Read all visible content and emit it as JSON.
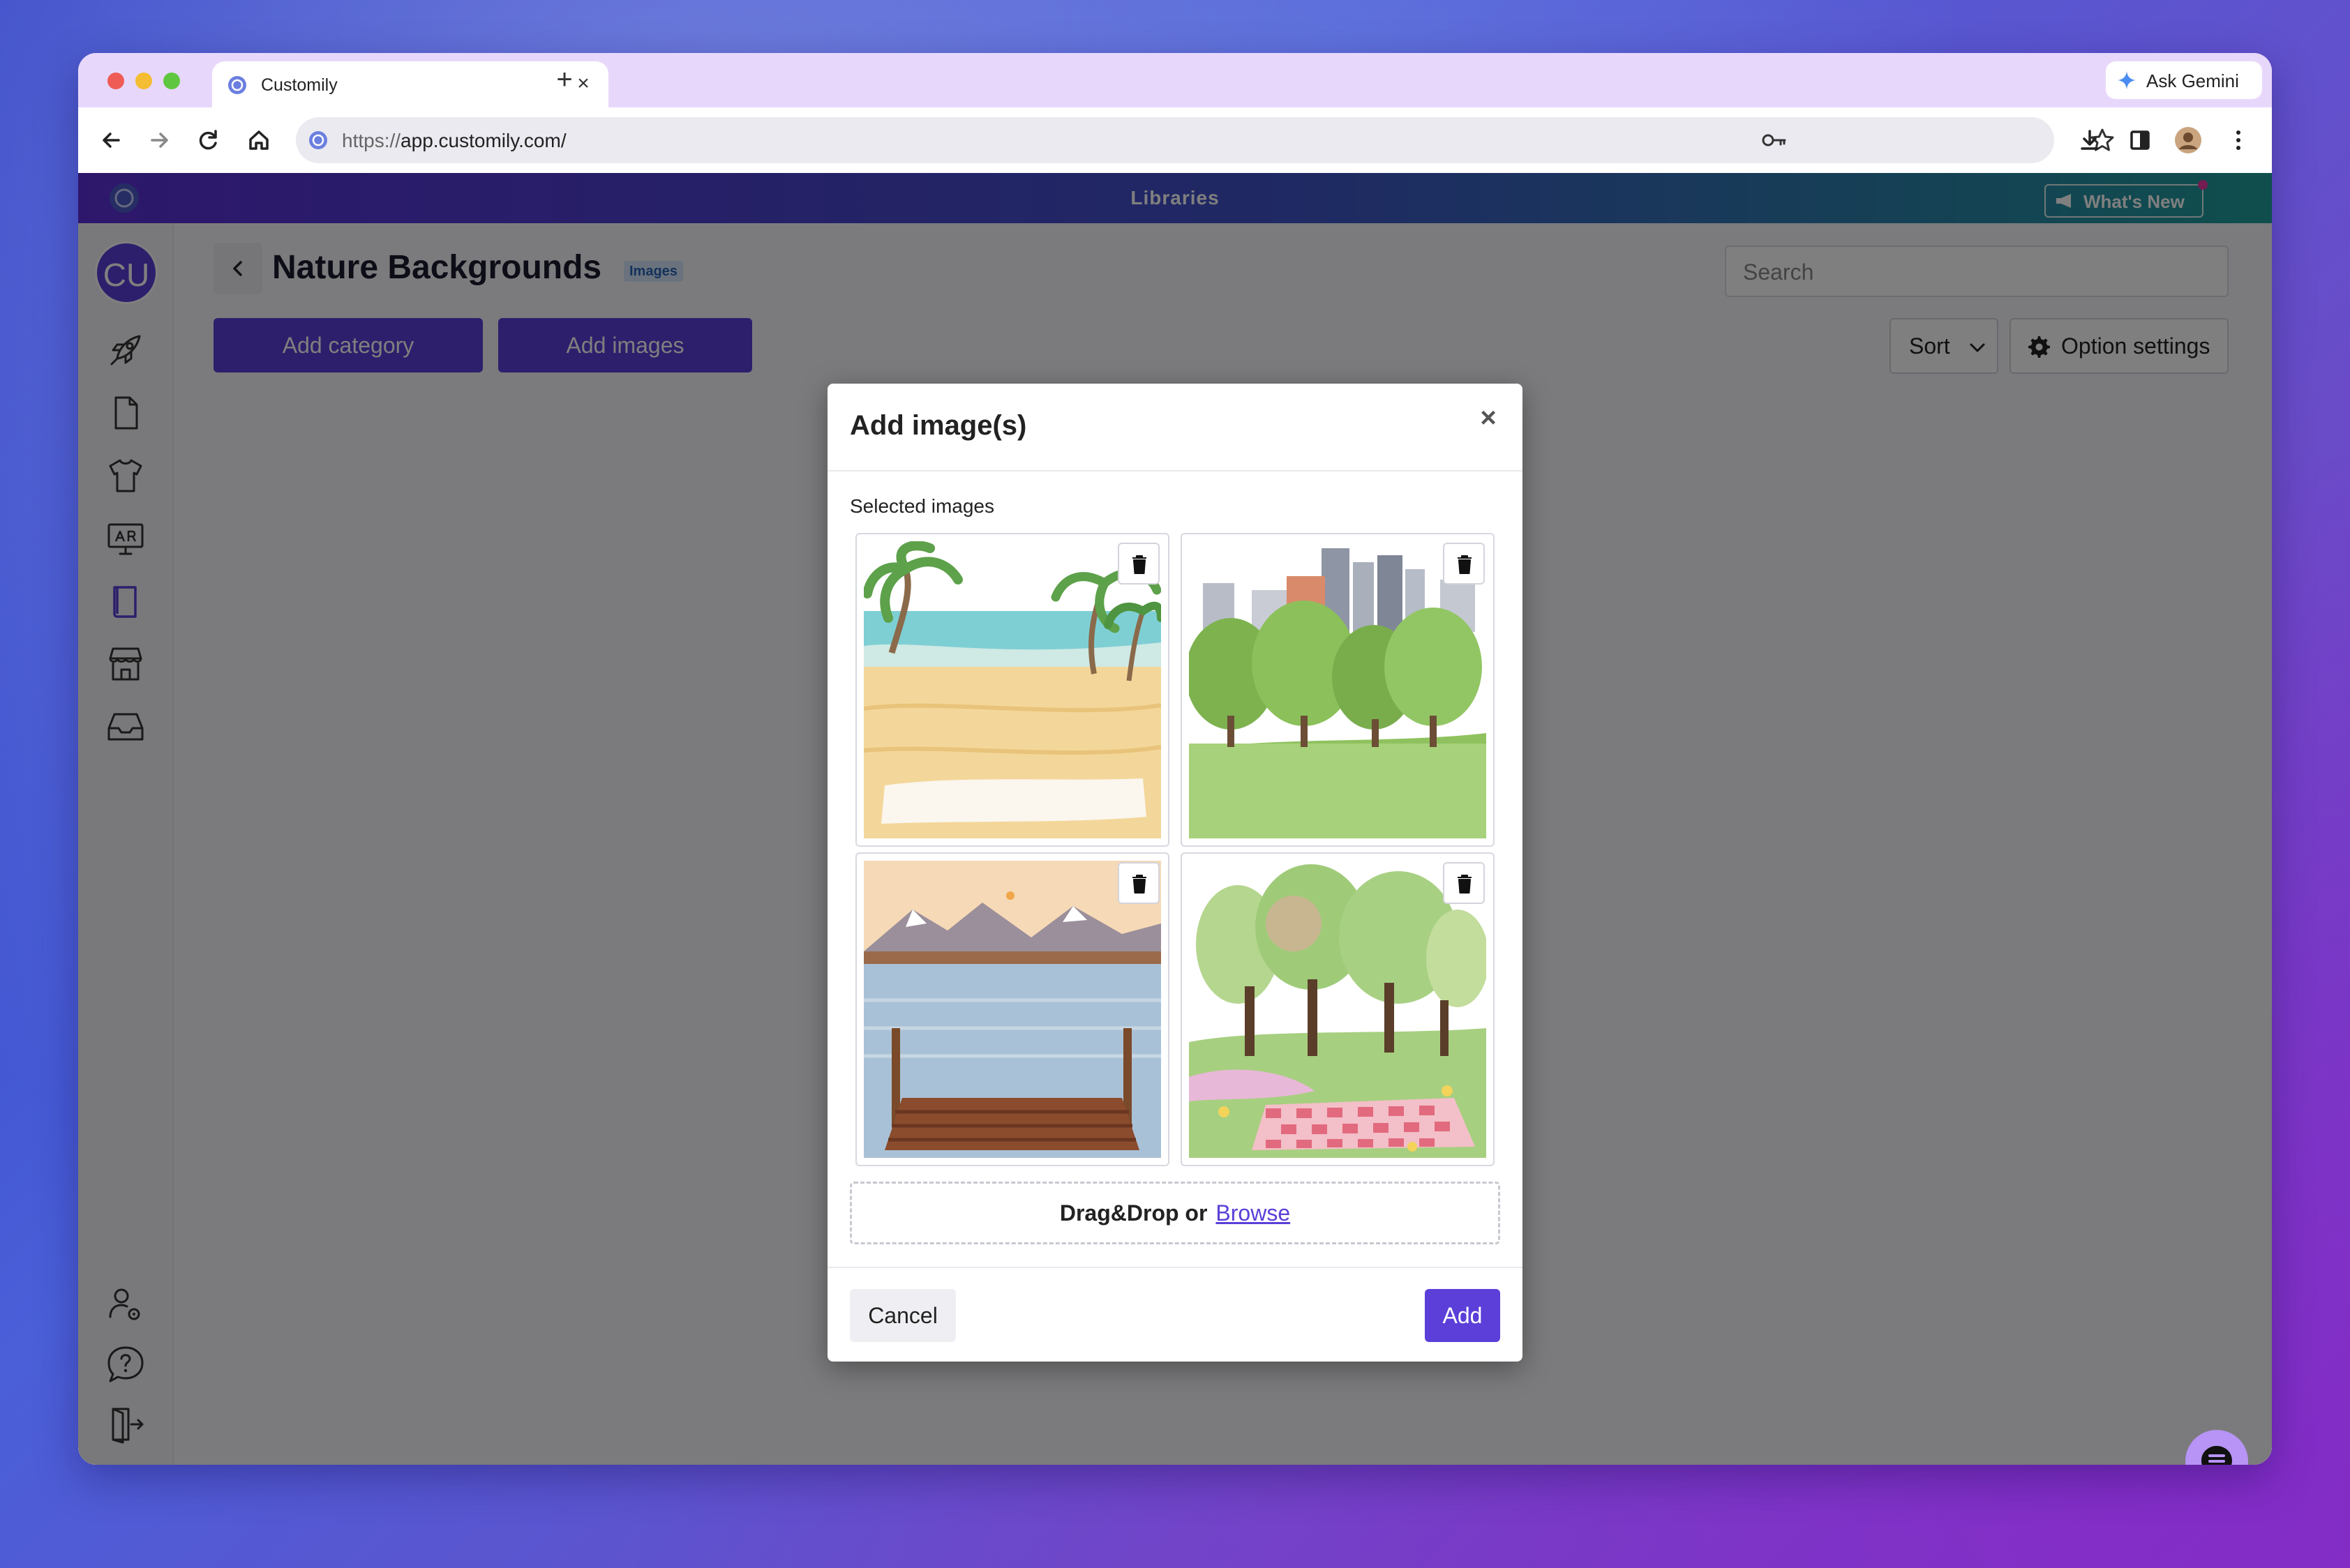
{
  "browser": {
    "tab_title": "Customily",
    "url_scheme": "https://",
    "url_host": "app.customily.com/",
    "gemini_label": "Ask Gemini"
  },
  "app": {
    "section_title": "Libraries",
    "whats_new_label": "What's New",
    "avatar_initials": "CU",
    "page_title": "Nature Backgrounds",
    "page_badge": "Images",
    "add_category_label": "Add category",
    "add_images_label": "Add images",
    "search_placeholder": "Search",
    "sort_label": "Sort",
    "option_settings_label": "Option settings"
  },
  "modal": {
    "title": "Add image(s)",
    "selected_label": "Selected images",
    "images": [
      {
        "subject": "beach"
      },
      {
        "subject": "city park"
      },
      {
        "subject": "lake dock"
      },
      {
        "subject": "picnic"
      }
    ],
    "drag_drop_text": "Drag&Drop or",
    "browse_link": "Browse",
    "cancel_label": "Cancel",
    "add_label": "Add"
  },
  "colors": {
    "brand_primary": "#5b3fd8",
    "tab_strip": "#e7d8fb",
    "chat_bubble": "#b794f6"
  }
}
